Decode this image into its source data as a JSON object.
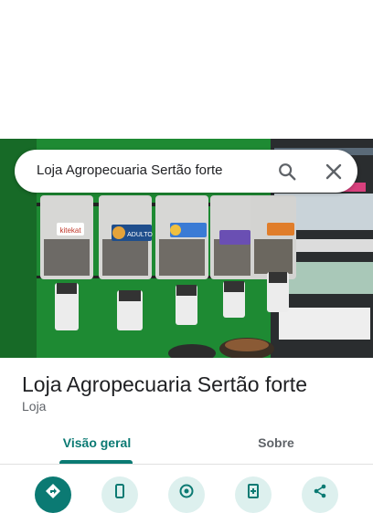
{
  "search": {
    "query": "Loja Agropecuaria Sertão forte"
  },
  "place": {
    "title": "Loja Agropecuaria Sertão forte",
    "category": "Loja"
  },
  "tabs": [
    {
      "label": "Visão geral",
      "selected": true
    },
    {
      "label": "Sobre",
      "selected": false
    }
  ],
  "actions": [
    {
      "icon": "directions-icon"
    },
    {
      "icon": "phone-icon"
    },
    {
      "icon": "location-share-icon"
    },
    {
      "icon": "save-icon"
    },
    {
      "icon": "share-icon"
    }
  ],
  "photo": {
    "dispenser_labels": [
      "kitekat",
      "ADULTO",
      "",
      "",
      ""
    ]
  },
  "colors": {
    "accent": "#0b7a73",
    "accent_light": "#ddf0ee",
    "wall_green": "#1a7a2c"
  }
}
